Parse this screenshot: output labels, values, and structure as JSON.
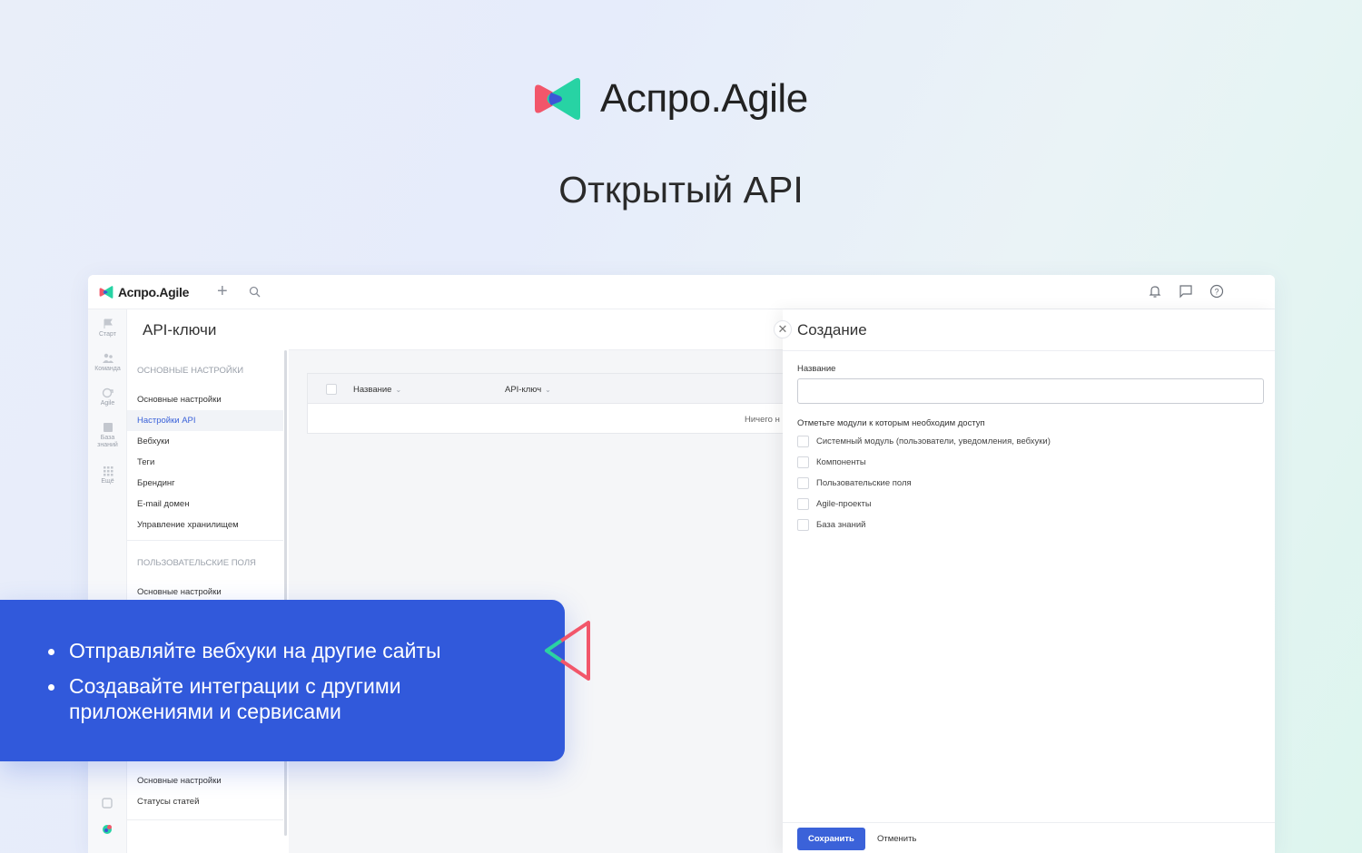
{
  "hero": {
    "brand": "Аспро.Agile",
    "subtitle": "Открытый API"
  },
  "topbar": {
    "brand": "Аспро.Agile",
    "icons": [
      "plus-icon",
      "search-icon",
      "bell-icon",
      "chat-icon",
      "help-icon"
    ]
  },
  "leftnav": {
    "items": [
      {
        "label": "Старт",
        "icon": "flag-icon"
      },
      {
        "label": "Команда",
        "icon": "team-icon"
      },
      {
        "label": "Agile",
        "icon": "agile-icon"
      },
      {
        "label": "База знаний",
        "icon": "book-icon"
      },
      {
        "label": "Ещё",
        "icon": "grid-icon"
      }
    ]
  },
  "page": {
    "title": "API-ключи"
  },
  "settings": {
    "section1_title": "ОСНОВНЫЕ НАСТРОЙКИ",
    "section1_items": [
      "Основные настройки",
      "Настройки API",
      "Вебхуки",
      "Теги",
      "Брендинг",
      "E-mail домен",
      "Управление хранилищем"
    ],
    "section2_title": "ПОЛЬЗОВАТЕЛЬСКИЕ ПОЛЯ",
    "section2_items": [
      "Основные настройки"
    ],
    "section3_items": [
      "Основные настройки",
      "Статусы статей"
    ],
    "active_item": "Настройки API"
  },
  "table": {
    "columns": [
      "Название",
      "API-ключ"
    ],
    "empty_text": "Ничего н"
  },
  "drawer": {
    "title": "Создание",
    "name_label": "Название",
    "name_value": "",
    "modules_label": "Отметьте модули к которым необходим доступ",
    "modules": [
      "Системный модуль (пользователи, уведомления, вебхуки)",
      "Компоненты",
      "Пользовательские поля",
      "Agile-проекты",
      "База знаний"
    ],
    "save_label": "Сохранить",
    "cancel_label": "Отменить"
  },
  "callout": {
    "bullets": [
      "Отправляйте вебхуки на другие сайты",
      "Создавайте интеграции с другими приложениями и сервисами"
    ]
  },
  "colors": {
    "accent": "#3b62d9",
    "callout_bg": "#3159db",
    "logo_teal": "#27d3a4",
    "logo_red": "#f2566a",
    "logo_blue": "#3b57d6"
  }
}
